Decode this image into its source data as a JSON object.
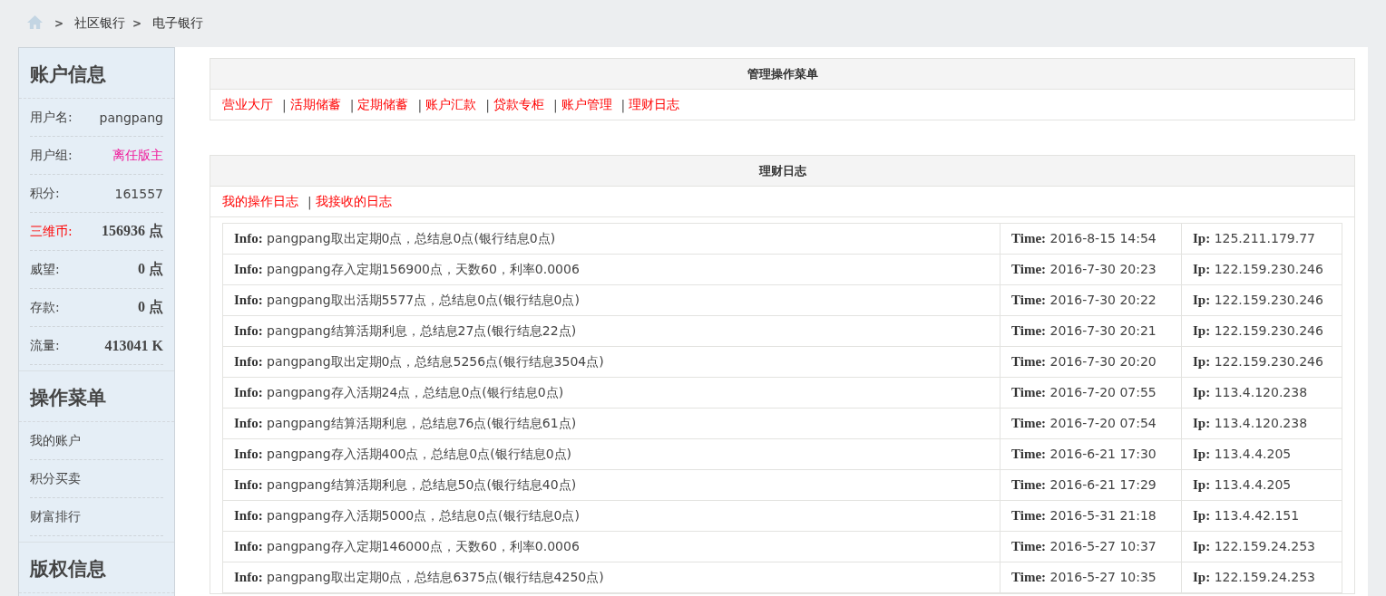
{
  "breadcrumb": {
    "separator": ">",
    "items": [
      "社区银行",
      "电子银行"
    ]
  },
  "sidebar": {
    "sections": [
      {
        "title": "账户信息",
        "rows": [
          {
            "kind": "plain",
            "label": "用户名:",
            "value": "pangpang"
          },
          {
            "kind": "rank",
            "label": "用户组:",
            "value": "离任版主"
          },
          {
            "kind": "plain",
            "label": "积分:",
            "value": "161557"
          },
          {
            "kind": "currency",
            "label": "三维币:",
            "value": "156936 点"
          },
          {
            "kind": "bold",
            "label": "威望:",
            "value": "0 点"
          },
          {
            "kind": "bold",
            "label": "存款:",
            "value": "0 点"
          },
          {
            "kind": "bold",
            "label": "流量:",
            "value": "413041 K"
          }
        ]
      },
      {
        "title": "操作菜单",
        "links": [
          "我的账户",
          "积分买卖",
          "财富排行"
        ]
      },
      {
        "title": "版权信息"
      }
    ]
  },
  "menu_panel": {
    "title": "管理操作菜单",
    "separator": "|",
    "links": [
      "营业大厅",
      "活期储蓄",
      "定期储蓄",
      "账户汇款",
      "贷款专柜",
      "账户管理",
      "理财日志"
    ]
  },
  "log_panel": {
    "title": "理财日志",
    "separator": "|",
    "tabs": [
      "我的操作日志",
      "我接收的日志"
    ],
    "rows": [
      {
        "info": "**Info:** pangpang取出定期0点，总结息0点(银行结息0点)",
        "time": "**Time:** 2016-8-15 14:54",
        "ip": "**Ip:** 125.211.179.77"
      },
      {
        "info": "**Info:** pangpang存入定期156900点，天数60，利率0.0006",
        "time": "**Time:** 2016-7-30 20:23",
        "ip": "**Ip:** 122.159.230.246"
      },
      {
        "info": "**Info:** pangpang取出活期5577点，总结息0点(银行结息0点)",
        "time": "**Time:** 2016-7-30 20:22",
        "ip": "**Ip:** 122.159.230.246"
      },
      {
        "info": "**Info:** pangpang结算活期利息，总结息27点(银行结息22点)",
        "time": "**Time:** 2016-7-30 20:21",
        "ip": "**Ip:** 122.159.230.246"
      },
      {
        "info": "**Info:** pangpang取出定期0点，总结息5256点(银行结息3504点)",
        "time": "**Time:** 2016-7-30 20:20",
        "ip": "**Ip:** 122.159.230.246"
      },
      {
        "info": "**Info:** pangpang存入活期24点，总结息0点(银行结息0点)",
        "time": "**Time:** 2016-7-20 07:55",
        "ip": "**Ip:** 113.4.120.238"
      },
      {
        "info": "**Info:** pangpang结算活期利息，总结息76点(银行结息61点)",
        "time": "**Time:** 2016-7-20 07:54",
        "ip": "**Ip:** 113.4.120.238"
      },
      {
        "info": "**Info:** pangpang存入活期400点，总结息0点(银行结息0点)",
        "time": "**Time:** 2016-6-21 17:30",
        "ip": "**Ip:** 113.4.4.205"
      },
      {
        "info": "**Info:** pangpang结算活期利息，总结息50点(银行结息40点)",
        "time": "**Time:** 2016-6-21 17:29",
        "ip": "**Ip:** 113.4.4.205"
      },
      {
        "info": "**Info:** pangpang存入活期5000点，总结息0点(银行结息0点)",
        "time": "**Time:** 2016-5-31 21:18",
        "ip": "**Ip:** 113.4.42.151"
      },
      {
        "info": "**Info:** pangpang存入定期146000点，天数60，利率0.0006",
        "time": "**Time:** 2016-5-27 10:37",
        "ip": "**Ip:** 122.159.24.253"
      },
      {
        "info": "**Info:** pangpang取出定期0点，总结息6375点(银行结息4250点)",
        "time": "**Time:** 2016-5-27 10:35",
        "ip": "**Ip:** 122.159.24.253"
      }
    ]
  }
}
